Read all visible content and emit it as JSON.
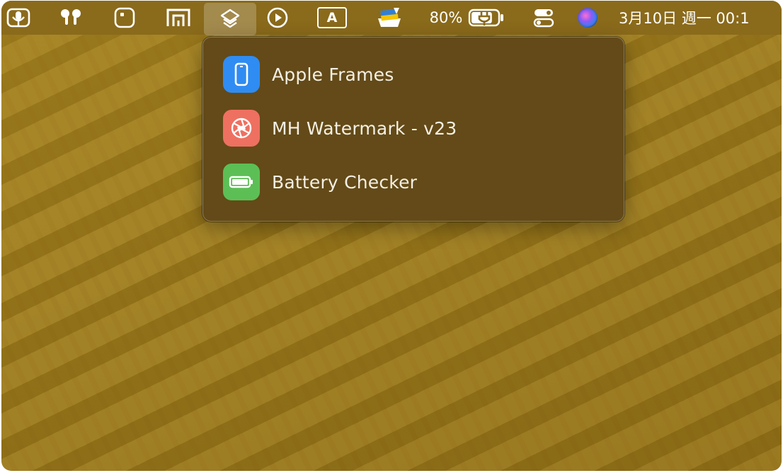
{
  "menubar": {
    "icons": [
      {
        "name": "dictation-icon"
      },
      {
        "name": "airpods-icon"
      },
      {
        "name": "app-square-icon"
      },
      {
        "name": "screen-mirror-icon"
      },
      {
        "name": "shortcuts-icon",
        "active": true
      },
      {
        "name": "play-circle-icon"
      },
      {
        "name": "input-source-icon",
        "label": "A"
      },
      {
        "name": "tray-app-icon"
      },
      {
        "name": "control-center-icon"
      },
      {
        "name": "siri-icon"
      }
    ],
    "battery_percent_label": "80%",
    "battery_level": 0.8,
    "battery_charging": true,
    "clock": "3月10日 週一  00:1"
  },
  "shortcuts_menu": {
    "items": [
      {
        "label": "Apple Frames",
        "icon": "phone-icon",
        "color": "#2f8cf2"
      },
      {
        "label": "MH Watermark - v23",
        "icon": "aperture-icon",
        "color": "#ee7060"
      },
      {
        "label": "Battery Checker",
        "icon": "battery-icon",
        "color": "#5cbf55"
      }
    ]
  },
  "colors": {
    "menubar": "#8a6a1b",
    "desktop": "#a48427",
    "menu_bg": "#634a18"
  }
}
